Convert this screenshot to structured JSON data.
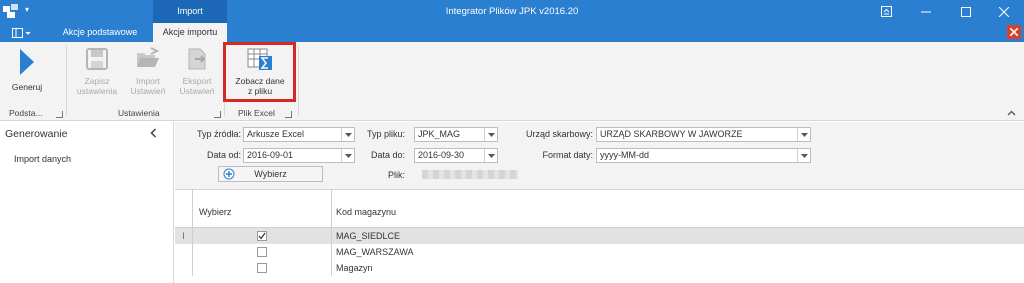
{
  "window": {
    "title": "Integrator Plików JPK v2016.20",
    "context_tab_header": "Import"
  },
  "ribbon_tabs": [
    {
      "label": "Akcje podstawowe"
    },
    {
      "label": "Akcje importu"
    }
  ],
  "ribbon": {
    "buttons": {
      "generuj": "Generuj",
      "zapisz_1": "Zapisz",
      "zapisz_2": "ustawienia",
      "import_1": "Import",
      "import_2": "Ustawień",
      "eksport_1": "Eksport",
      "eksport_2": "Ustawień",
      "zobacz_1": "Zobacz dane",
      "zobacz_2": "z pliku"
    },
    "groups": {
      "podstawowe": "Podsta...",
      "ustawienia": "Ustawienia",
      "plik_excel": "Plik Excel"
    }
  },
  "left_panel": {
    "header": "Generowanie",
    "items": [
      "Import danych"
    ]
  },
  "form": {
    "typ_zrodla_label": "Typ źródła:",
    "typ_zrodla_value": "Arkusze Excel",
    "typ_pliku_label": "Typ pliku:",
    "typ_pliku_value": "JPK_MAG",
    "urzad_label": "Urząd skarbowy:",
    "urzad_value": "URZĄD SKARBOWY W JAWORZE",
    "data_od_label": "Data od:",
    "data_od_value": "2016-09-01",
    "data_do_label": "Data do:",
    "data_do_value": "2016-09-30",
    "format_daty_label": "Format daty:",
    "format_daty_value": "yyyy-MM-dd",
    "wybierz_button": "Wybierz",
    "plik_label": "Plik:"
  },
  "grid": {
    "columns": [
      "Wybierz",
      "Kod magazynu"
    ],
    "rows": [
      {
        "checked": true,
        "kod": "MAG_SIEDLCE"
      },
      {
        "checked": false,
        "kod": "MAG_WARSZAWA"
      },
      {
        "checked": false,
        "kod": "Magazyn"
      }
    ]
  },
  "colors": {
    "titlebar": "#2b7fd0",
    "context_tab": "#1d68b6",
    "highlight": "#d42a23",
    "close": "#d9412b"
  }
}
